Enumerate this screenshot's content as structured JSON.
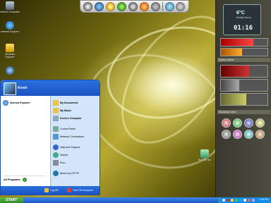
{
  "desktop_icons": [
    {
      "label": "Kevin's Computer"
    },
    {
      "label": "Internet Explorer"
    },
    {
      "label": "Windows Explorer"
    },
    {
      "label": ""
    },
    {
      "label": "Recycle Bin"
    }
  ],
  "sidebar": {
    "temperature": "6°C",
    "condition": "Mostly Sunny",
    "clock": "01:16",
    "panel_gauges_title": "System Meter",
    "panel_orbs_title": "Shutdown Orbs"
  },
  "start_menu": {
    "user_name": "Kevin",
    "left_items": [
      {
        "label": "Internet Explorer",
        "icon": "ie-icon"
      }
    ],
    "right_items": [
      {
        "label": "My Documents",
        "icon": "folder-icon"
      },
      {
        "label": "My Music",
        "icon": "music-icon"
      },
      {
        "label": "Kevin's Computer",
        "icon": "computer-icon"
      },
      {
        "label": "Control Panel",
        "icon": "control-panel-icon"
      },
      {
        "label": "Network Connections",
        "icon": "network-icon"
      },
      {
        "label": "Help and Support",
        "icon": "help-icon"
      },
      {
        "label": "Search",
        "icon": "search-icon"
      },
      {
        "label": "Run...",
        "icon": "run-icon"
      },
      {
        "label": "About my HP PC",
        "icon": "info-icon"
      }
    ],
    "all_programs": "All Programs",
    "log_off": "Log Off",
    "turn_off": "Turn Off Computer"
  },
  "taskbar": {
    "start_label": "START",
    "clock": "1:46 PM"
  },
  "colors": {
    "start_menu_blue": "#1a53c4",
    "start_green": "#2f8b24"
  }
}
